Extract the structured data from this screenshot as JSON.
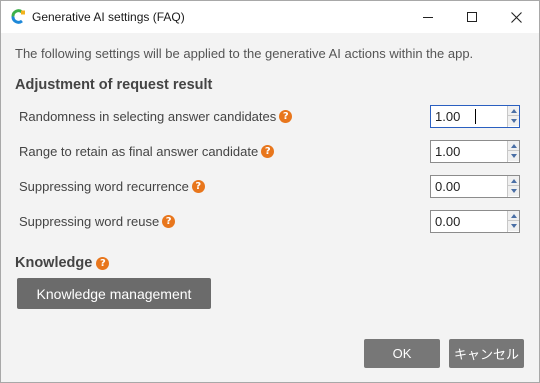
{
  "window": {
    "title": "Generative AI settings (FAQ)",
    "icon": "app-logo-icon"
  },
  "description": "The following settings will be applied to the generative AI actions within the app.",
  "adjustment": {
    "title": "Adjustment of request result",
    "rows": [
      {
        "label": "Randomness in selecting answer candidates",
        "value": "1.00"
      },
      {
        "label": "Range to retain as final answer candidate",
        "value": "1.00"
      },
      {
        "label": "Suppressing word recurrence",
        "value": "0.00"
      },
      {
        "label": "Suppressing word reuse",
        "value": "0.00"
      }
    ]
  },
  "knowledge": {
    "title": "Knowledge",
    "button_label": "Knowledge management"
  },
  "footer": {
    "ok_label": "OK",
    "cancel_label": "キャンセル"
  },
  "help_glyph": "?",
  "colors": {
    "help_icon": "#e8761c",
    "button_bg": "#6b6b6b",
    "spinner_arrow": "#4a6fa5",
    "focus_border": "#2a5fc0"
  }
}
